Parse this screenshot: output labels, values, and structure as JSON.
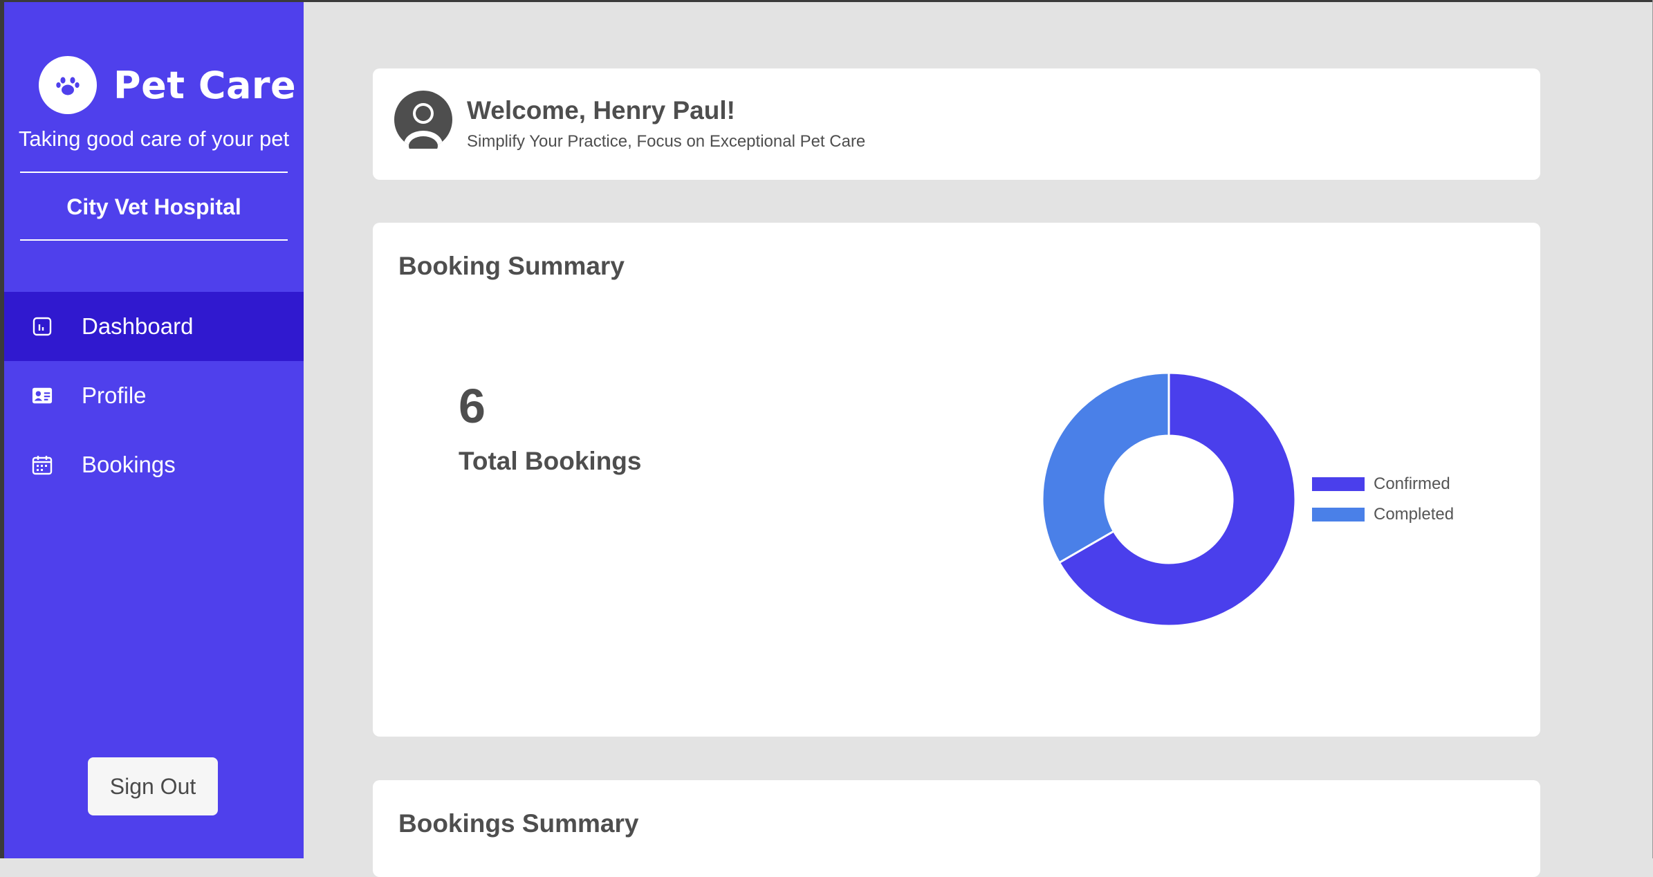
{
  "brand": {
    "name": "Pet Care",
    "tagline": "Taking good care of your pet",
    "hospital": "City Vet Hospital"
  },
  "nav": {
    "items": [
      {
        "label": "Dashboard",
        "icon": "dashboard-chart-icon",
        "active": true
      },
      {
        "label": "Profile",
        "icon": "id-card-icon",
        "active": false
      },
      {
        "label": "Bookings",
        "icon": "calendar-icon",
        "active": false
      }
    ]
  },
  "signout_label": "Sign Out",
  "welcome": {
    "title": "Welcome, Henry Paul!",
    "subtitle": "Simplify Your Practice, Focus on Exceptional Pet Care"
  },
  "booking_summary": {
    "title": "Booking Summary",
    "total": "6",
    "total_label": "Total Bookings"
  },
  "bookings_summary_title": "Bookings Summary",
  "colors": {
    "sidebar": "#4f40ec",
    "sidebar_active": "#3019cf",
    "confirmed": "#4a3fec",
    "completed": "#4a80e8",
    "text": "#4e4e4e"
  },
  "chart_data": {
    "type": "pie",
    "donut": true,
    "categories": [
      "Confirmed",
      "Completed"
    ],
    "values": [
      4,
      2
    ],
    "colors": [
      "#4a3fec",
      "#4a80e8"
    ],
    "legend": "right"
  }
}
